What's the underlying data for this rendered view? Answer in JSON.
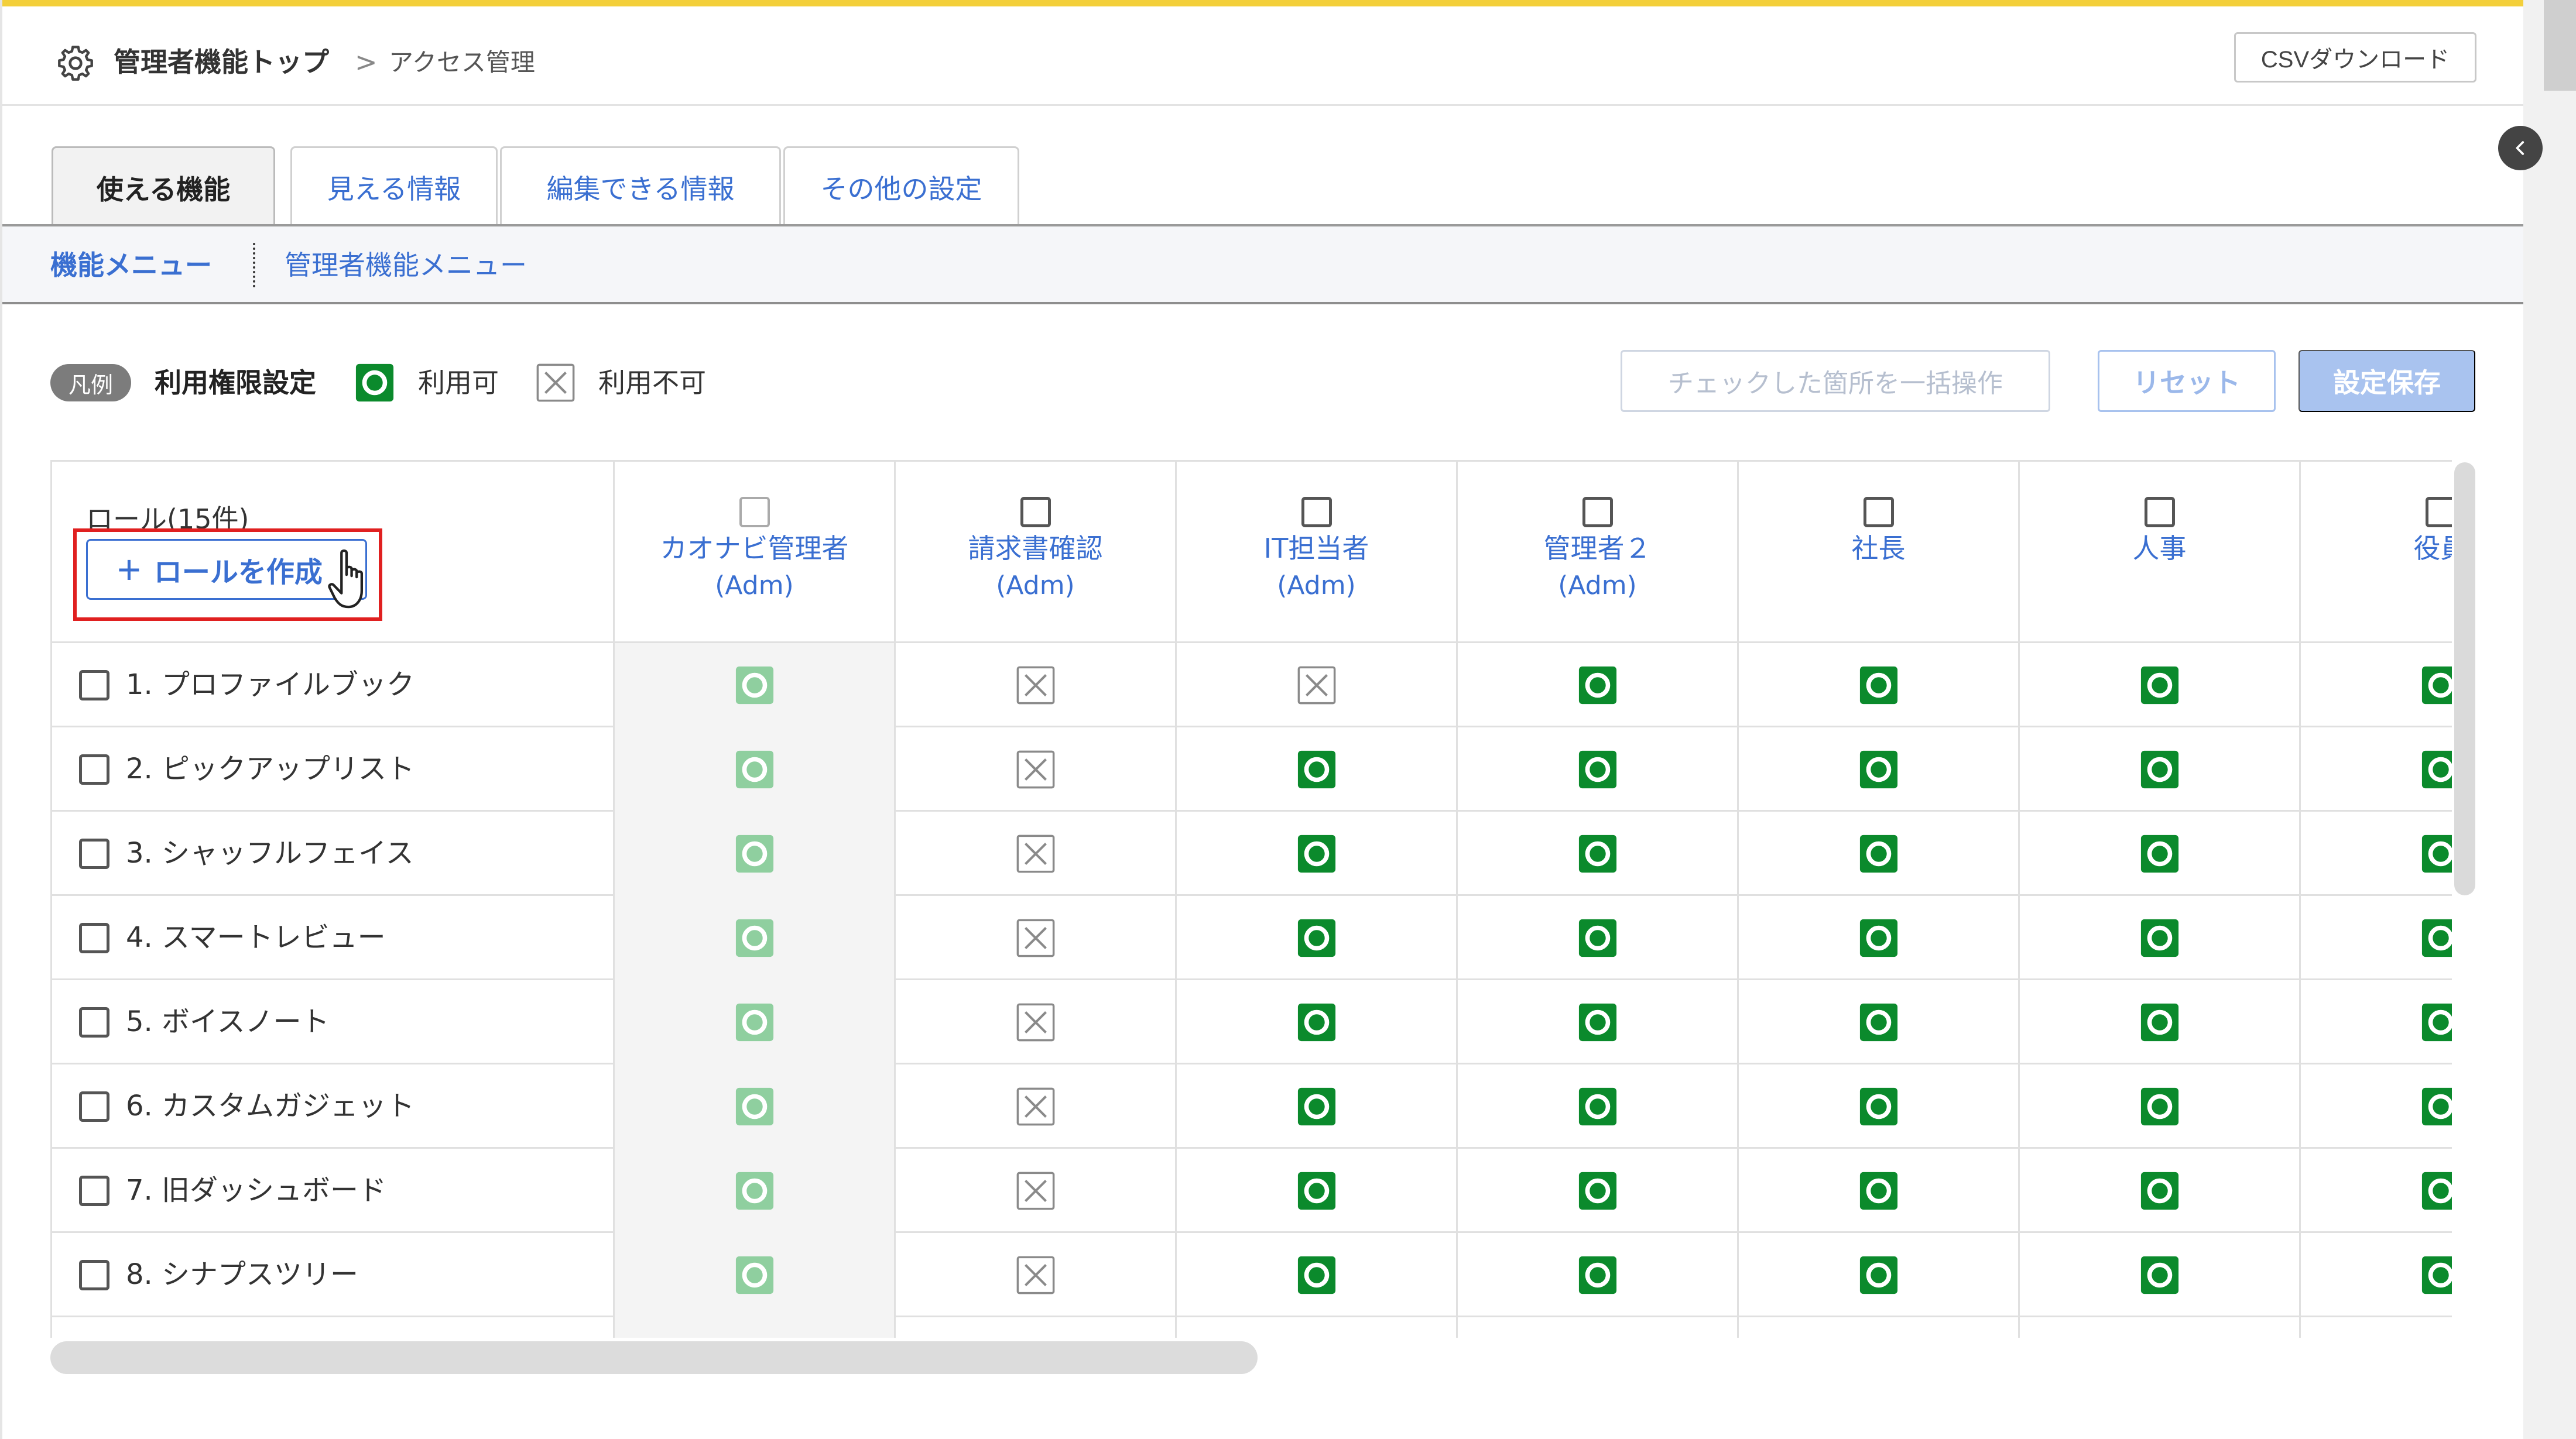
{
  "header": {
    "breadcrumb_top": "管理者機能トップ",
    "breadcrumb_sep": ">",
    "breadcrumb_current": "アクセス管理",
    "csv_button": "CSVダウンロード"
  },
  "tabs": [
    {
      "label": "使える機能",
      "active": true
    },
    {
      "label": "見える情報",
      "active": false
    },
    {
      "label": "編集できる情報",
      "active": false
    },
    {
      "label": "その他の設定",
      "active": false
    }
  ],
  "subnav": {
    "items": [
      {
        "label": "機能メニュー",
        "active": true
      },
      {
        "label": "管理者機能メニュー",
        "active": false
      }
    ]
  },
  "legend": {
    "badge": "凡例",
    "title": "利用権限設定",
    "ok_label": "利用可",
    "ng_label": "利用不可"
  },
  "actions": {
    "bulk": "チェックした箇所を一括操作",
    "reset": "リセット",
    "save": "設定保存"
  },
  "table": {
    "role_count": "ロール(15件)",
    "create_role": "ロールを作成",
    "columns": [
      {
        "name": "カオナビ管理者",
        "sub": "(Adm)"
      },
      {
        "name": "請求書確認",
        "sub": "(Adm)"
      },
      {
        "name": "IT担当者",
        "sub": "(Adm)"
      },
      {
        "name": "管理者２",
        "sub": "(Adm)"
      },
      {
        "name": "社長",
        "sub": ""
      },
      {
        "name": "人事",
        "sub": ""
      },
      {
        "name": "役員",
        "sub": ""
      }
    ],
    "rows": [
      {
        "label": "1. プロファイルブック",
        "perms": [
          "ok-light",
          "ng",
          "ng",
          "ok",
          "ok",
          "ok",
          "ok"
        ]
      },
      {
        "label": "2. ピックアップリスト",
        "perms": [
          "ok-light",
          "ng",
          "ok",
          "ok",
          "ok",
          "ok",
          "ok"
        ]
      },
      {
        "label": "3. シャッフルフェイス",
        "perms": [
          "ok-light",
          "ng",
          "ok",
          "ok",
          "ok",
          "ok",
          "ok"
        ]
      },
      {
        "label": "4. スマートレビュー",
        "perms": [
          "ok-light",
          "ng",
          "ok",
          "ok",
          "ok",
          "ok",
          "ok"
        ]
      },
      {
        "label": "5. ボイスノート",
        "perms": [
          "ok-light",
          "ng",
          "ok",
          "ok",
          "ok",
          "ok",
          "ok"
        ]
      },
      {
        "label": "6. カスタムガジェット",
        "perms": [
          "ok-light",
          "ng",
          "ok",
          "ok",
          "ok",
          "ok",
          "ok"
        ]
      },
      {
        "label": "7. 旧ダッシュボード",
        "perms": [
          "ok-light",
          "ng",
          "ok",
          "ok",
          "ok",
          "ok",
          "ok"
        ]
      },
      {
        "label": "8. シナプスツリー",
        "perms": [
          "ok-light",
          "ng",
          "ok",
          "ok",
          "ok",
          "ok",
          "ok"
        ]
      }
    ]
  },
  "colors": {
    "ok": "#0b8a2c",
    "ok_light": "#8fcf9f",
    "ng": "#8a8a8a",
    "link": "#3a6fd1",
    "accent": "#f3cf3a"
  }
}
